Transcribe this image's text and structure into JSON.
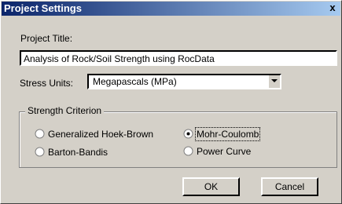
{
  "dialog": {
    "title": "Project Settings",
    "close_symbol": "x"
  },
  "project_title": {
    "label": "Project Title:",
    "value": "Analysis of Rock/Soil Strength using RocData"
  },
  "stress_units": {
    "label": "Stress Units:",
    "selected": "Megapascals (MPa)"
  },
  "strength_criterion": {
    "legend": "Strength Criterion",
    "options": [
      {
        "label": "Generalized Hoek-Brown",
        "checked": false
      },
      {
        "label": "Mohr-Coulomb",
        "checked": true
      },
      {
        "label": "Barton-Bandis",
        "checked": false
      },
      {
        "label": "Power Curve",
        "checked": false
      }
    ]
  },
  "buttons": {
    "ok": "OK",
    "cancel": "Cancel"
  },
  "colors": {
    "titlebar_start": "#0a246a",
    "titlebar_end": "#a6caf0",
    "dialog_bg": "#d4d0c8"
  },
  "icons": {
    "dropdown": "chevron-down-icon",
    "close": "close-icon"
  }
}
